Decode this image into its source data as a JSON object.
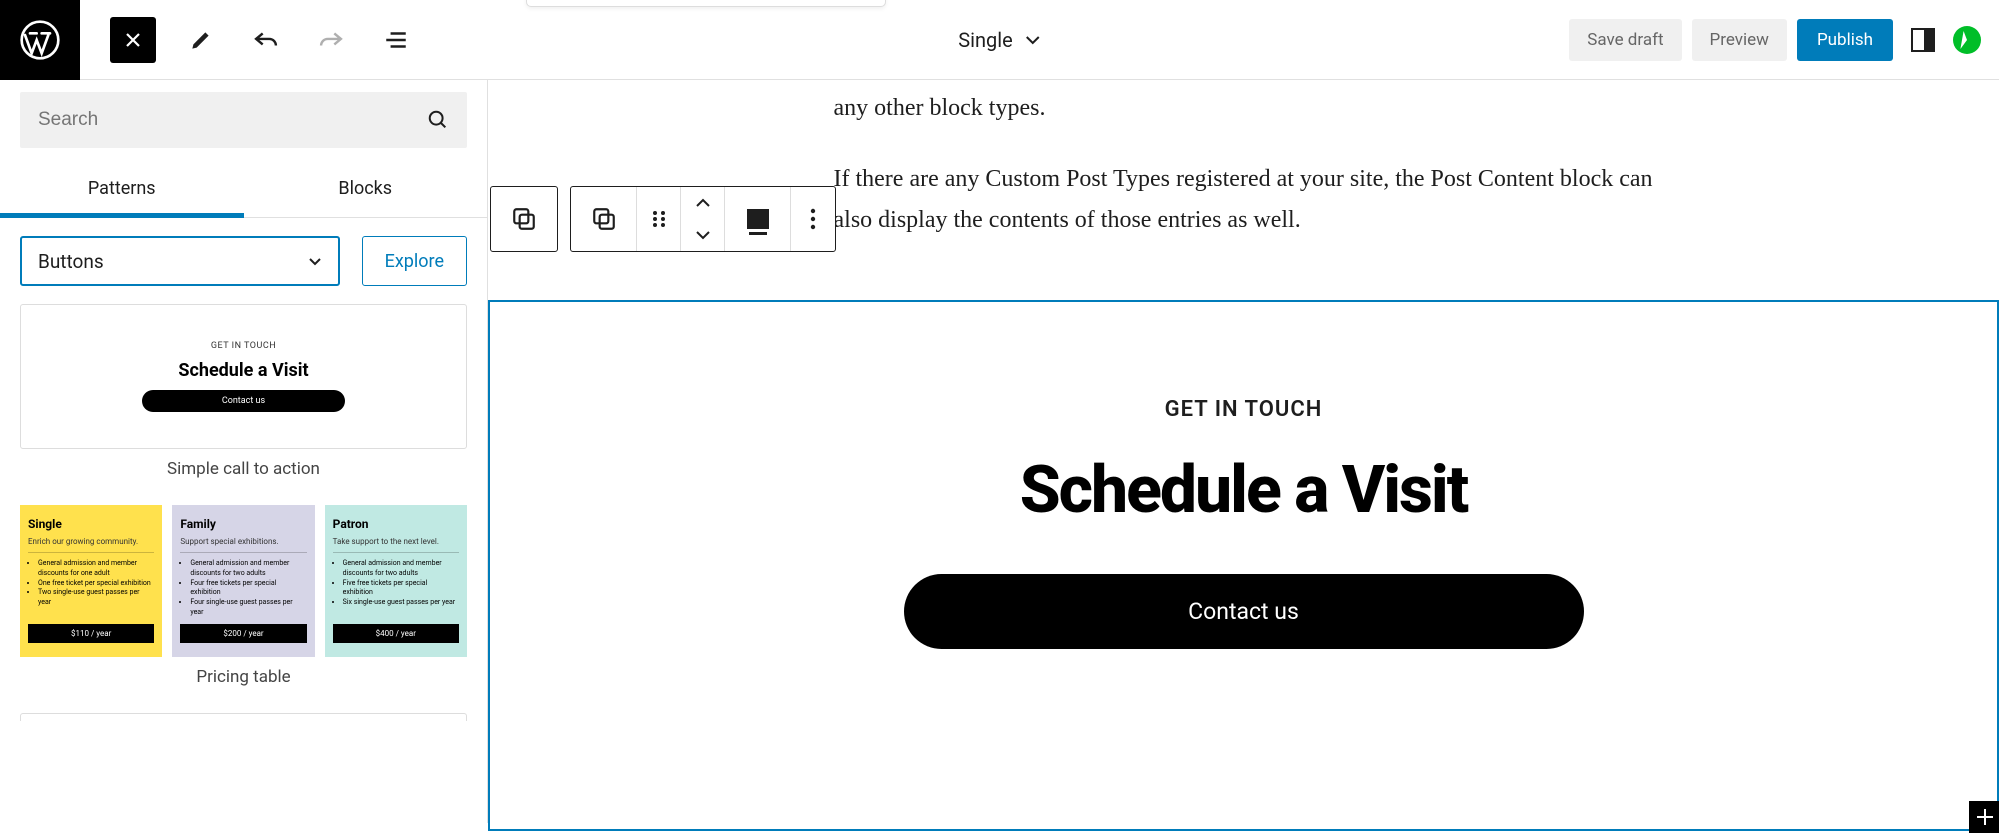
{
  "topbar": {
    "doc_mode_label": "Single",
    "save_draft_label": "Save draft",
    "preview_label": "Preview",
    "publish_label": "Publish"
  },
  "sidebar": {
    "search_placeholder": "Search",
    "tabs": {
      "patterns": "Patterns",
      "blocks": "Blocks"
    },
    "category_selected": "Buttons",
    "explore_label": "Explore",
    "pattern1": {
      "eyebrow": "GET IN TOUCH",
      "title": "Schedule a Visit",
      "button": "Contact us",
      "caption": "Simple call to action"
    },
    "pattern2": {
      "caption": "Pricing table",
      "cols": [
        {
          "title": "Single",
          "sub": "Enrich our growing community.",
          "items": [
            "General admission and member discounts for one adult",
            "One free ticket per special exhibition",
            "Two single-use guest passes per year"
          ],
          "price": "$110 / year"
        },
        {
          "title": "Family",
          "sub": "Support special exhibitions.",
          "items": [
            "General admission and member discounts for two adults",
            "Four free tickets per special exhibition",
            "Four single-use guest passes per year"
          ],
          "price": "$200 / year"
        },
        {
          "title": "Patron",
          "sub": "Take support to the next level.",
          "items": [
            "General admission and member discounts for two adults",
            "Five free tickets per special exhibition",
            "Six single-use guest passes per year"
          ],
          "price": "$400 / year"
        }
      ]
    }
  },
  "canvas": {
    "paragraph1_tail": "any other block types.",
    "paragraph2": "If there are any Custom Post Types registered at your site, the Post Content block can also display the contents of those entries as well.",
    "cta": {
      "eyebrow": "GET IN TOUCH",
      "heading": "Schedule a Visit",
      "button": "Contact us"
    }
  }
}
